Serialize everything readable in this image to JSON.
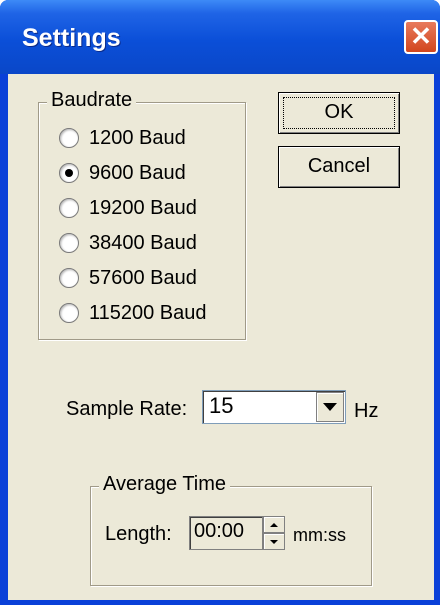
{
  "window": {
    "title": "Settings",
    "close_symbol": "✕",
    "close_icon": "close-icon"
  },
  "baudrate_group": {
    "legend": "Baudrate",
    "options": [
      {
        "label": "1200 Baud",
        "selected": false
      },
      {
        "label": "9600 Baud",
        "selected": true
      },
      {
        "label": "19200 Baud",
        "selected": false
      },
      {
        "label": "38400 Baud",
        "selected": false
      },
      {
        "label": "57600 Baud",
        "selected": false
      },
      {
        "label": "115200 Baud",
        "selected": false
      }
    ]
  },
  "buttons": {
    "ok_label": "OK",
    "cancel_label": "Cancel"
  },
  "sample_rate": {
    "label": "Sample Rate:",
    "value": "15",
    "unit": "Hz"
  },
  "average_time": {
    "legend": "Average Time",
    "length_label": "Length:",
    "value": "00:00",
    "unit": "mm:ss"
  },
  "colors": {
    "titlebar": "#0a4fd8",
    "client_bg": "#ece9d8",
    "close_button": "#d2461e"
  }
}
